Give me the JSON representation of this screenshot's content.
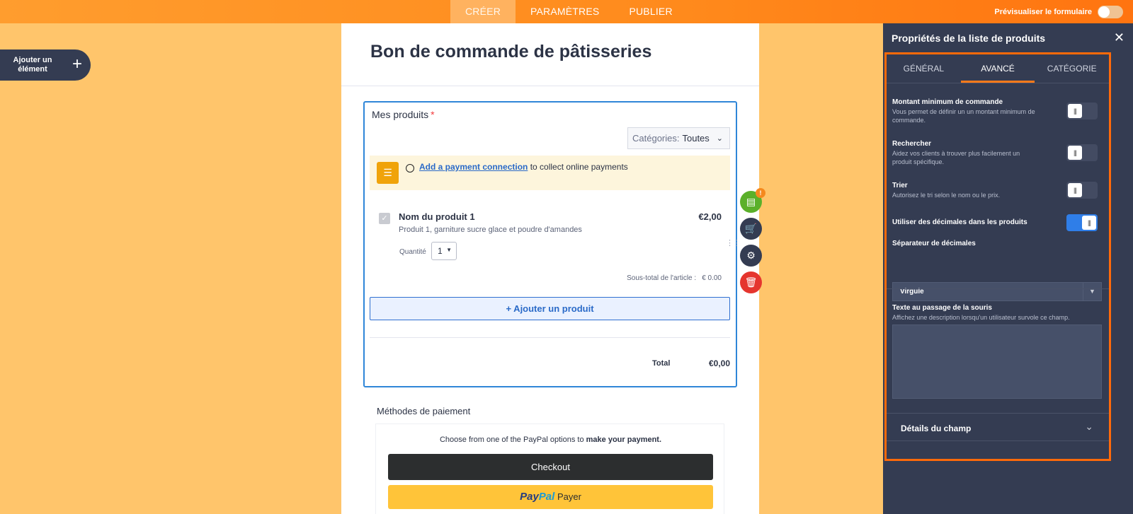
{
  "topbar": {
    "tabs": [
      {
        "label": "CRÉER",
        "active": true
      },
      {
        "label": "PARAMÈTRES",
        "active": false
      },
      {
        "label": "PUBLIER",
        "active": false
      }
    ],
    "preview_label": "Prévisualiser le formulaire"
  },
  "add_element": {
    "label": "Ajouter un élément",
    "icon": "plus-icon"
  },
  "form": {
    "title": "Bon de commande de pâtisseries",
    "field_label": "Mes produits",
    "required_mark": "*",
    "category_prefix": "Catégories:",
    "category_value": "Toutes",
    "notice_link": "Add a payment connection",
    "notice_text": "to collect online payments",
    "product": {
      "name": "Nom du produit 1",
      "description": "Produit 1, garniture sucre glace et poudre d'amandes",
      "price": "€2,00",
      "quantity_label": "Quantité",
      "quantity": "1",
      "subtotal_label": "Sous-total de l'article :",
      "subtotal_value": "€ 0.00"
    },
    "add_product": "+ Ajouter un produit",
    "total_label": "Total",
    "total_value": "€0,00",
    "payment_methods_title": "Méthodes de paiement",
    "paypal_intro": "Choose from one of the PayPal options to",
    "paypal_intro_bold": "make your payment.",
    "checkout": "Checkout",
    "paypal_brand_1": "Pay",
    "paypal_brand_2": "Pal",
    "paypal_pay": "Payer"
  },
  "side_buttons": {
    "badge": "!"
  },
  "panel": {
    "title": "Propriétés de la liste de produits",
    "tabs": [
      {
        "label": "GÉNÉRAL",
        "active": false
      },
      {
        "label": "AVANCÉ",
        "active": true
      },
      {
        "label": "CATÉGORIE",
        "active": false
      }
    ],
    "options": [
      {
        "title": "Montant minimum de commande",
        "desc": "Vous permet de définir un un montant minimum de commande.",
        "on": false
      },
      {
        "title": "Rechercher",
        "desc": "Aidez vos clients à trouver plus facilement un produit spécifique.",
        "on": false
      },
      {
        "title": "Trier",
        "desc": "Autorisez le tri selon le nom ou le prix.",
        "on": false
      },
      {
        "title": "Utiliser des décimales dans les produits",
        "desc": "",
        "on": true
      }
    ],
    "separator_title": "Séparateur de décimales",
    "separator_value": "Virgule",
    "tooltip_title": "Texte au passage de la souris",
    "tooltip_desc": "Affichez une description lorsqu'un utilisateur survole ce champ.",
    "details_title": "Détails du champ"
  },
  "colors": {
    "accent": "#ff7a1a",
    "canvas": "#ffc56b",
    "panel": "#343c52",
    "field_border": "#2f86d8"
  }
}
